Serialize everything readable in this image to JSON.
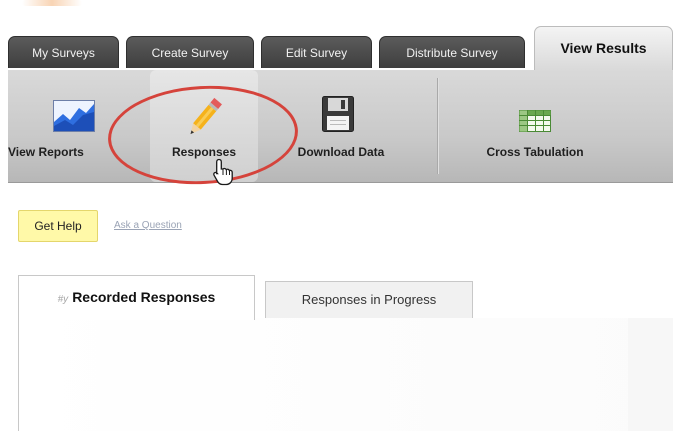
{
  "nav_tabs": [
    {
      "label": "My Surveys"
    },
    {
      "label": "Create Survey"
    },
    {
      "label": "Edit Survey"
    },
    {
      "label": "Distribute Survey"
    },
    {
      "label": "View Results"
    }
  ],
  "active_tab": "View Results",
  "toolbar": {
    "items": [
      {
        "label": "View Reports",
        "icon": "chart-icon"
      },
      {
        "label": "Responses",
        "icon": "pencil-icon"
      },
      {
        "label": "Download Data",
        "icon": "floppy-disk-icon"
      },
      {
        "label": "Cross Tabulation",
        "icon": "spreadsheet-icon"
      }
    ],
    "selected": "Responses"
  },
  "help": {
    "button_label": "Get Help",
    "ask_link": "Ask a Question"
  },
  "response_tabs": [
    {
      "label": "Recorded Responses",
      "icon_glyph": "#y"
    },
    {
      "label": "Responses in Progress"
    }
  ],
  "colors": {
    "highlight_circle": "#d5433b",
    "help_button": "#fff9a8",
    "tab_dark": "#4a4a4a"
  }
}
